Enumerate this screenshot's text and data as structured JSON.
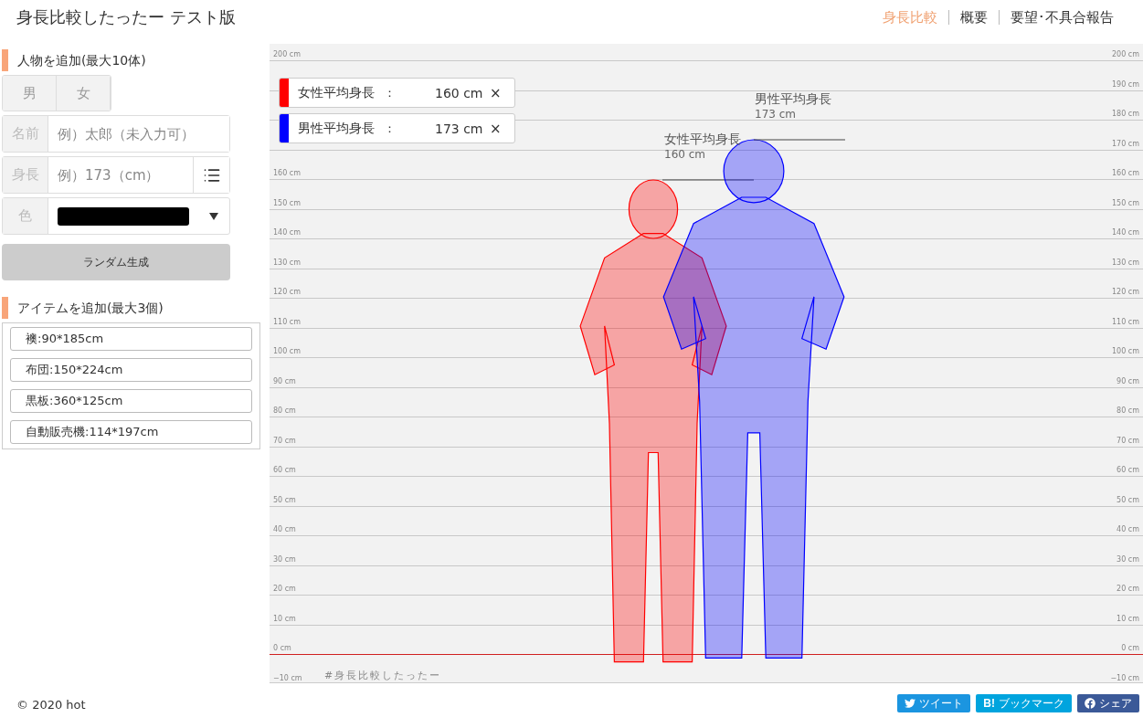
{
  "header": {
    "title": "身長比較したったー テスト版",
    "nav": [
      {
        "label": "身長比較",
        "selected": true
      },
      {
        "label": "概要",
        "selected": false
      },
      {
        "label": "要望･不具合報告",
        "selected": false
      }
    ]
  },
  "add_person": {
    "heading": "人物を追加(最大10体)",
    "gender_buttons": [
      {
        "label": "男",
        "selected": false
      },
      {
        "label": "女",
        "selected": false
      }
    ],
    "name_field": {
      "label": "名前",
      "placeholder": "例）太郎（未入力可）"
    },
    "height_field": {
      "label": "身長",
      "placeholder": "例）173（cm）"
    },
    "color_field": {
      "label": "色",
      "color": "#000000"
    },
    "random_button": "ランダム生成"
  },
  "add_item": {
    "heading": "アイテムを追加(最大3個)",
    "items": [
      "襖:90*185cm",
      "布団:150*224cm",
      "黒板:360*125cm",
      "自動販売機:114*197cm"
    ]
  },
  "chart": {
    "scale": [
      {
        "left": "200 cm",
        "right": "200 cm"
      },
      {
        "right": "190 cm"
      },
      {
        "right": "180 cm"
      },
      {
        "right": "170 cm"
      },
      {
        "left": "160 cm",
        "right": "160 cm"
      },
      {
        "left": "150 cm",
        "right": "150 cm"
      },
      {
        "left": "140 cm",
        "right": "140 cm"
      },
      {
        "left": "130 cm",
        "right": "130 cm"
      },
      {
        "left": "120 cm",
        "right": "120 cm"
      },
      {
        "left": "110 cm",
        "right": "110 cm"
      },
      {
        "left": "100 cm",
        "right": "100 cm"
      },
      {
        "left": "90 cm",
        "right": "90 cm"
      },
      {
        "left": "80 cm",
        "right": "80 cm"
      },
      {
        "left": "70 cm",
        "right": "70 cm"
      },
      {
        "left": "60 cm",
        "right": "60 cm"
      },
      {
        "left": "50 cm",
        "right": "50 cm"
      },
      {
        "left": "40 cm",
        "right": "40 cm"
      },
      {
        "left": "30 cm",
        "right": "30 cm"
      },
      {
        "left": "20 cm",
        "right": "20 cm"
      },
      {
        "left": "10 cm",
        "right": "10 cm"
      },
      {
        "left": "0 cm",
        "right": "0 cm"
      },
      {
        "left": "−10 cm",
        "right": "−10 cm"
      }
    ],
    "people": [
      {
        "color": "#ff0000",
        "legend": {
          "name": "女性平均身長",
          "colon": "：",
          "height": "160 cm",
          "close": "×"
        },
        "annotation": {
          "name": "女性平均身長",
          "height": "160 cm"
        }
      },
      {
        "color": "#0000ff",
        "legend": {
          "name": "男性平均身長",
          "colon": "：",
          "height": "173 cm",
          "close": "×"
        },
        "annotation": {
          "name": "男性平均身長",
          "height": "173 cm"
        }
      }
    ],
    "hashtag": "#身長比較したったー"
  },
  "footer": {
    "copyright": "© 2020 hot",
    "share_buttons": [
      {
        "kind": "twitter",
        "label": "ツイート"
      },
      {
        "kind": "hatena",
        "mark": "B!",
        "label": "ブックマーク"
      },
      {
        "kind": "facebook",
        "label": "シェア"
      }
    ]
  }
}
